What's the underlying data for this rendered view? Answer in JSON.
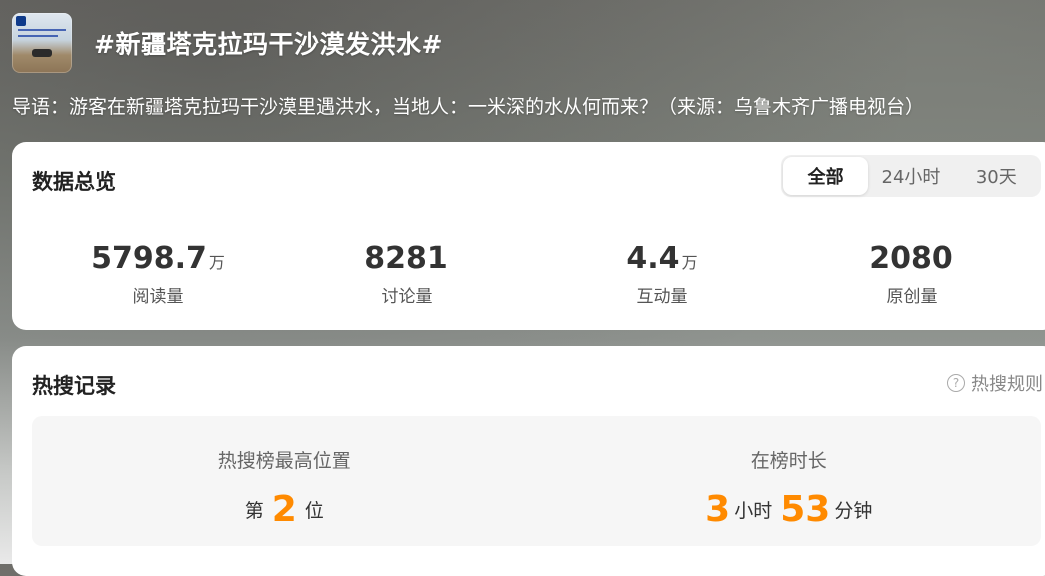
{
  "topic": {
    "title": "#新疆塔克拉玛干沙漠发洪水#",
    "guide": "导语：游客在新疆塔克拉玛干沙漠里遇洪水，当地人：一米深的水从何而来？（来源：乌鲁木齐广播电视台）",
    "thumbnail_icon": "news-thumbnail"
  },
  "overview": {
    "title": "数据总览",
    "tabs": [
      "全部",
      "24小时",
      "30天"
    ],
    "active_tab": "全部",
    "stats": [
      {
        "value": "5798.7",
        "unit": "万",
        "label": "阅读量"
      },
      {
        "value": "8281",
        "unit": "",
        "label": "讨论量"
      },
      {
        "value": "4.4",
        "unit": "万",
        "label": "互动量"
      },
      {
        "value": "2080",
        "unit": "",
        "label": "原创量"
      }
    ]
  },
  "records": {
    "title": "热搜记录",
    "rules_label": "热搜规则",
    "peak_label": "热搜榜最高位置",
    "peak_prefix": "第",
    "peak_value": "2",
    "peak_suffix": "位",
    "duration_label": "在榜时长",
    "hours_value": "3",
    "hours_unit": "小时",
    "minutes_value": "53",
    "minutes_unit": "分钟"
  },
  "colors": {
    "accent": "#ff8a00"
  }
}
